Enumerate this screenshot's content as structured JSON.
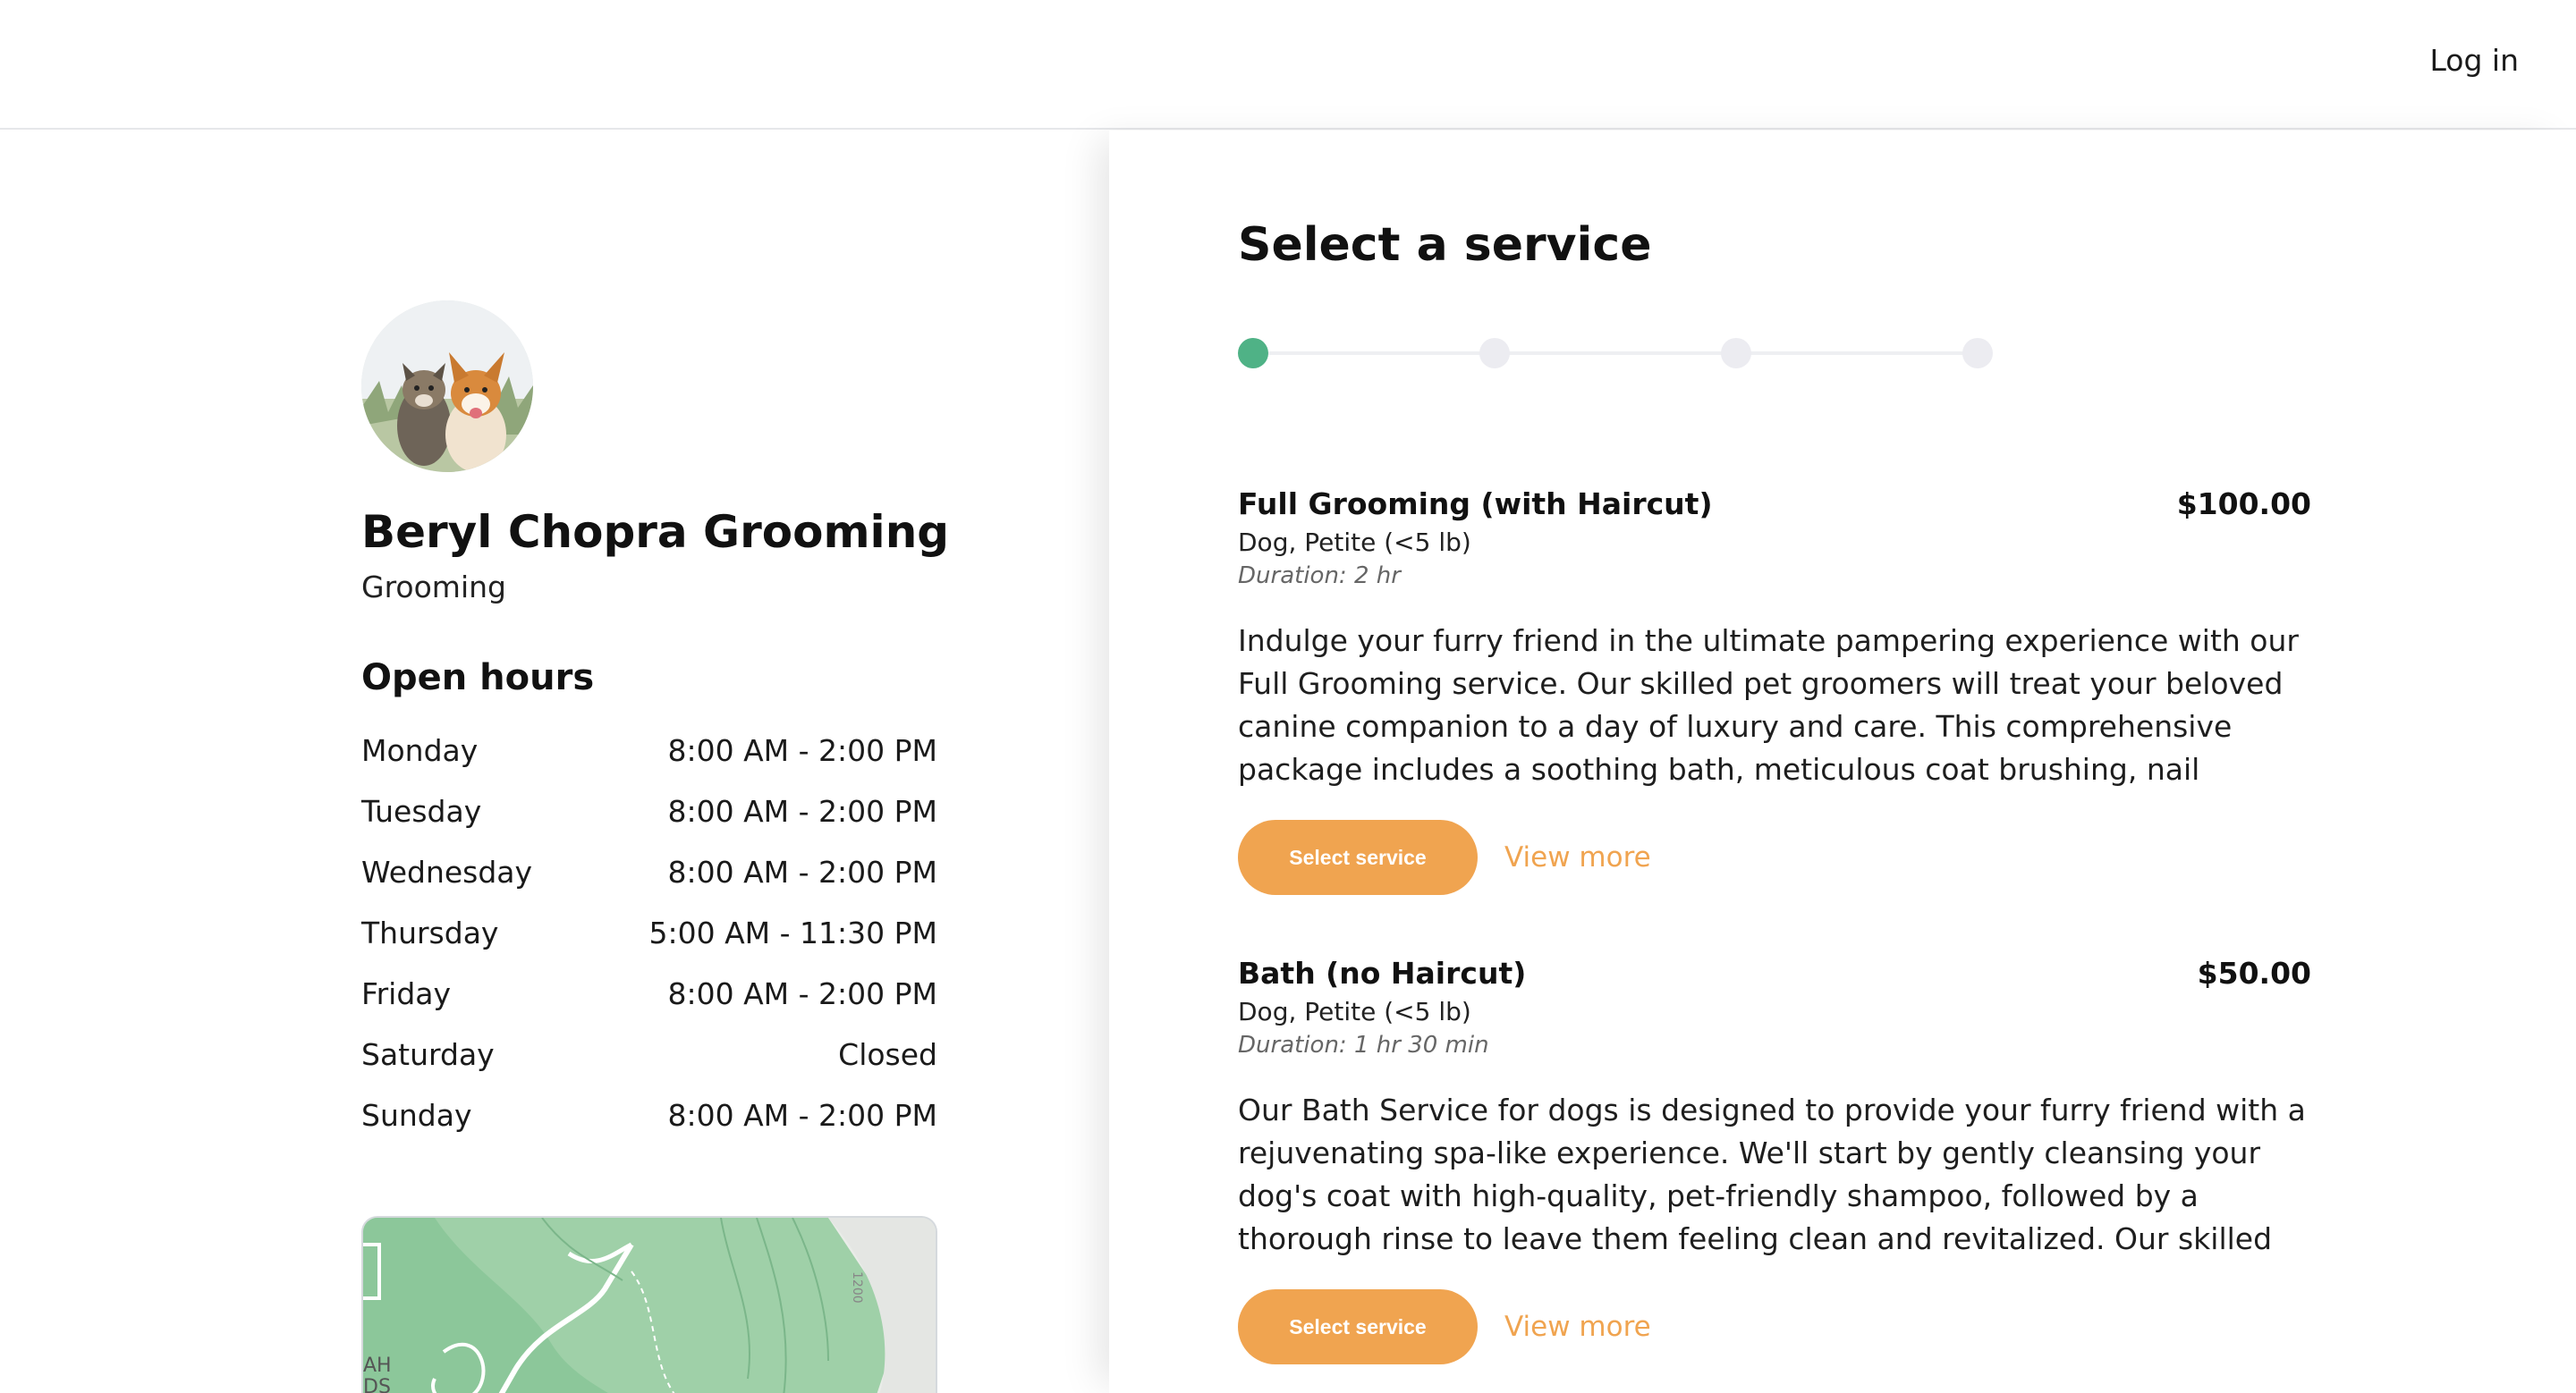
{
  "header": {
    "login_label": "Log in"
  },
  "business": {
    "name": "Beryl Chopra Grooming",
    "category": "Grooming",
    "hours_title": "Open hours",
    "hours": [
      {
        "day": "Monday",
        "time": "8:00 AM - 2:00 PM"
      },
      {
        "day": "Tuesday",
        "time": "8:00 AM - 2:00 PM"
      },
      {
        "day": "Wednesday",
        "time": "8:00 AM - 2:00 PM"
      },
      {
        "day": "Thursday",
        "time": "5:00 AM - 11:30 PM"
      },
      {
        "day": "Friday",
        "time": "8:00 AM - 2:00 PM"
      },
      {
        "day": "Saturday",
        "time": "Closed"
      },
      {
        "day": "Sunday",
        "time": "8:00 AM - 2:00 PM"
      }
    ]
  },
  "booking": {
    "title": "Select a service",
    "current_step": 1,
    "total_steps": 4,
    "services": [
      {
        "name": "Full Grooming (with Haircut)",
        "price": "$100.00",
        "subtitle": "Dog, Petite (<5 lb)",
        "duration": "Duration: 2 hr",
        "description": "Indulge your furry friend in the ultimate pampering experience with our Full Grooming service. Our skilled pet groomers will treat your beloved canine companion to a day of luxury and care. This comprehensive package includes a soothing bath, meticulous coat brushing, nail trimming, ear…",
        "select_label": "Select service",
        "view_more_label": "View more"
      },
      {
        "name": "Bath (no Haircut)",
        "price": "$50.00",
        "subtitle": "Dog, Petite (<5 lb)",
        "duration": "Duration: 1 hr 30 min",
        "description": "Our Bath Service for dogs is designed to provide your furry friend with a rejuvenating spa-like experience. We'll start by gently cleansing your dog's coat with high-quality, pet-friendly shampoo, followed by a thorough rinse to leave them feeling clean and revitalized. Our skilled groomers will also…",
        "select_label": "Select service",
        "view_more_label": "View more"
      }
    ]
  },
  "map": {
    "contour_label": "1200",
    "area_label_1": "AH",
    "area_label_2": "DS"
  },
  "colors": {
    "accent": "#f0a450",
    "step_active": "#4fb286",
    "step_inactive": "#ececf1"
  }
}
